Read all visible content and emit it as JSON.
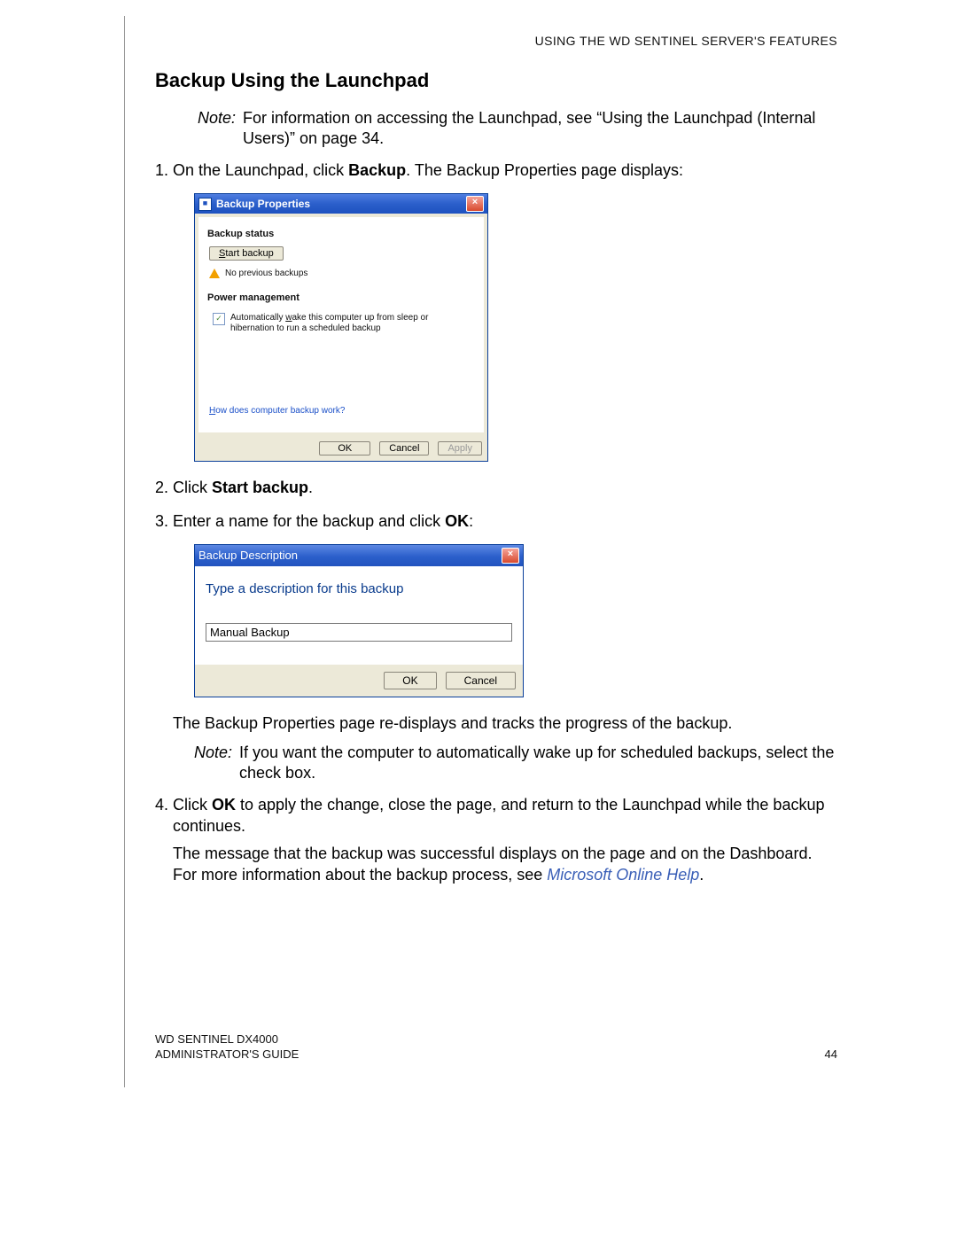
{
  "header": {
    "chapter": "USING THE WD SENTINEL SERVER'S FEATURES"
  },
  "section": {
    "title": "Backup Using the Launchpad"
  },
  "note1": {
    "label": "Note:",
    "text": "For information on accessing the Launchpad, see “Using the Launchpad (Internal Users)” on page 34."
  },
  "step1": {
    "pre": "On the Launchpad, click ",
    "bold": "Backup",
    "post": ". The Backup Properties page displays:"
  },
  "dialog1": {
    "title": "Backup Properties",
    "close": "×",
    "group1_label": "Backup status",
    "start_button": "Start backup",
    "warn_text": "No previous backups",
    "group2_label": "Power management",
    "check_pre": "Automatically ",
    "check_u": "w",
    "check_rest": "ake this computer up from sleep or hibernation to run a scheduled backup",
    "help_pre": "H",
    "help_rest": "ow does computer backup work?",
    "ok": "OK",
    "cancel": "Cancel",
    "apply": "Apply",
    "start_u": "S",
    "start_rest": "tart backup"
  },
  "step2": {
    "pre": "Click ",
    "bold": "Start backup",
    "post": "."
  },
  "step3": {
    "pre": "Enter a name for the backup and click ",
    "bold": "OK",
    "post": ":"
  },
  "dialog2": {
    "title": "Backup Description",
    "close": "×",
    "prompt": "Type a description for this backup",
    "input_value": "Manual Backup",
    "ok": "OK",
    "cancel": "Cancel"
  },
  "afterD2": "The Backup Properties page re-displays and tracks the progress of the backup.",
  "note2": {
    "label": "Note:",
    "text": "If you want the computer to automatically wake up for scheduled backups, select the check box."
  },
  "step4a": {
    "pre": "Click ",
    "bold": "OK",
    "post": " to apply the change, close the page, and return to the Launchpad while the backup continues."
  },
  "step4b": {
    "pre": "The message that the backup was successful displays on the page and on the Dashboard. For more information about the backup process, see ",
    "link": "Microsoft Online Help",
    "post": "."
  },
  "footer": {
    "line1": "WD SENTINEL DX4000",
    "line2": "ADMINISTRATOR'S GUIDE",
    "pagenum": "44"
  }
}
